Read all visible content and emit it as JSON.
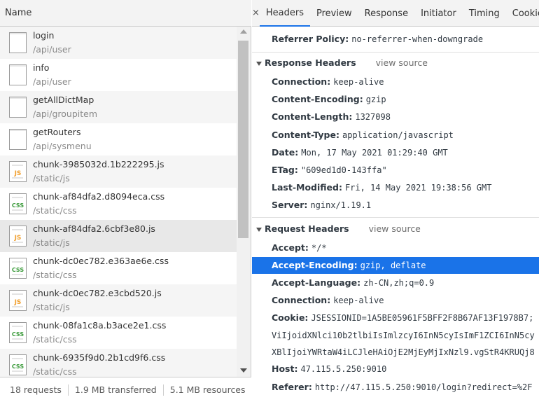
{
  "network": {
    "name_header": "Name",
    "requests": [
      {
        "name": "login",
        "path": "/api/user",
        "type": "doc"
      },
      {
        "name": "info",
        "path": "/api/user",
        "type": "doc"
      },
      {
        "name": "getAllDictMap",
        "path": "/api/groupitem",
        "type": "doc"
      },
      {
        "name": "getRouters",
        "path": "/api/sysmenu",
        "type": "doc"
      },
      {
        "name": "chunk-3985032d.1b222295.js",
        "path": "/static/js",
        "type": "js"
      },
      {
        "name": "chunk-af84dfa2.d8094eca.css",
        "path": "/static/css",
        "type": "css"
      },
      {
        "name": "chunk-af84dfa2.6cbf3e80.js",
        "path": "/static/js",
        "type": "js"
      },
      {
        "name": "chunk-dc0ec782.e363ae6e.css",
        "path": "/static/css",
        "type": "css"
      },
      {
        "name": "chunk-dc0ec782.e3cbd520.js",
        "path": "/static/js",
        "type": "js"
      },
      {
        "name": "chunk-08fa1c8a.b3ace2e1.css",
        "path": "/static/css",
        "type": "css"
      },
      {
        "name": "chunk-6935f9d0.2b1cd9f6.css",
        "path": "/static/css",
        "type": "css"
      }
    ],
    "status": {
      "requests": "18 requests",
      "transferred": "1.9 MB transferred",
      "resources": "5.1 MB resources"
    }
  },
  "details": {
    "close": "×",
    "tabs": [
      "Headers",
      "Preview",
      "Response",
      "Initiator",
      "Timing",
      "Cookies"
    ],
    "active_tab": "Headers",
    "referrer_policy": {
      "key": "Referrer Policy:",
      "value": "no-referrer-when-downgrade"
    },
    "response_headers": {
      "title": "Response Headers",
      "view_source": "view source",
      "items": [
        {
          "key": "Connection:",
          "value": "keep-alive"
        },
        {
          "key": "Content-Encoding:",
          "value": "gzip"
        },
        {
          "key": "Content-Length:",
          "value": "1327098"
        },
        {
          "key": "Content-Type:",
          "value": "application/javascript"
        },
        {
          "key": "Date:",
          "value": "Mon, 17 May 2021 01:29:40 GMT"
        },
        {
          "key": "ETag:",
          "value": "\"609ed1d0-143ffa\""
        },
        {
          "key": "Last-Modified:",
          "value": "Fri, 14 May 2021 19:38:56 GMT"
        },
        {
          "key": "Server:",
          "value": "nginx/1.19.1"
        }
      ]
    },
    "request_headers": {
      "title": "Request Headers",
      "view_source": "view source",
      "accept": {
        "key": "Accept:",
        "value": "*/*"
      },
      "accept_encoding": {
        "key": "Accept-Encoding:",
        "value": "gzip, deflate"
      },
      "accept_language": {
        "key": "Accept-Language:",
        "value": "zh-CN,zh;q=0.9"
      },
      "connection": {
        "key": "Connection:",
        "value": "keep-alive"
      },
      "cookie": {
        "key": "Cookie:",
        "value": "JSESSIONID=1A5BE05961F5BFF2F8B67AF13F1978B7;"
      },
      "cookie_line2": "ViIjoidXNlci10b2tlbiIsImlzcyI6InN5cyIsImF1ZCI6InN5cy",
      "cookie_line3": "XBlIjoiYWRtaW4iLCJleHAiOjE2MjEyMjIxNzl9.vgStR4KRUQj8",
      "host": {
        "key": "Host:",
        "value": "47.115.5.250:9010"
      },
      "referer": {
        "key": "Referer:",
        "value": "http://47.115.5.250:9010/login?redirect=%2F"
      }
    }
  },
  "colors": {
    "accent": "#1a73e8",
    "js_icon": "#f0a030",
    "css_icon": "#3a9a3a"
  }
}
